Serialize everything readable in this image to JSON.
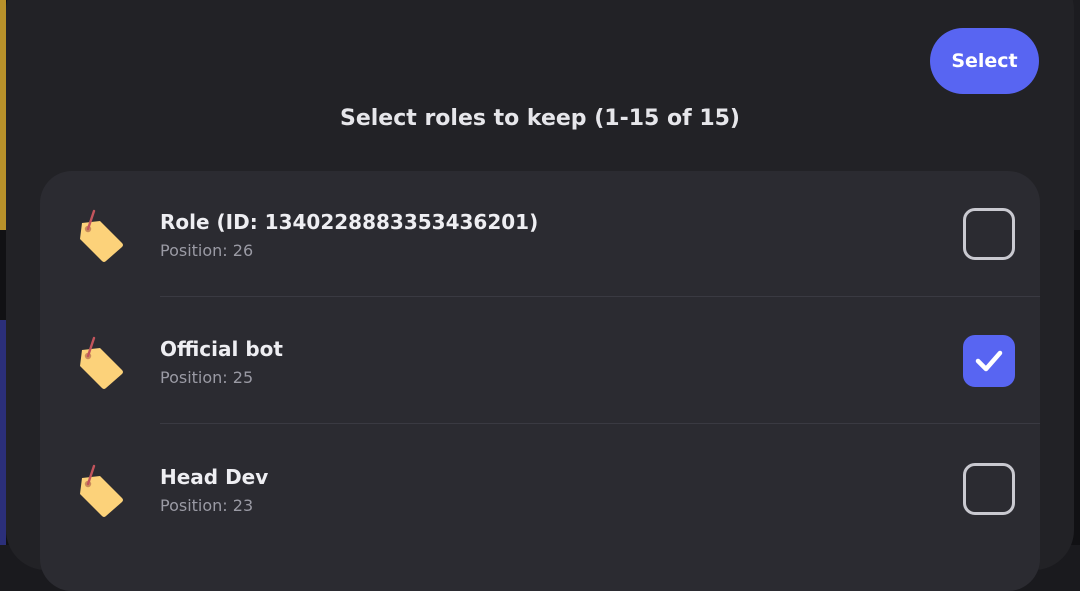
{
  "header": {
    "select_label": "Select",
    "title": "Select roles to keep (1-15 of 15)"
  },
  "roles": [
    {
      "name": "Role (ID: 1340228883353436201)",
      "position": "Position: 26",
      "checked": false,
      "icon": "tag-icon"
    },
    {
      "name": "Official bot",
      "position": "Position: 25",
      "checked": true,
      "icon": "tag-icon"
    },
    {
      "name": "Head Dev",
      "position": "Position: 23",
      "checked": false,
      "icon": "tag-icon"
    }
  ],
  "colors": {
    "accent": "#5865f2",
    "sheet": "#222226",
    "list": "#2b2b31",
    "tag": "#fcd27a"
  }
}
